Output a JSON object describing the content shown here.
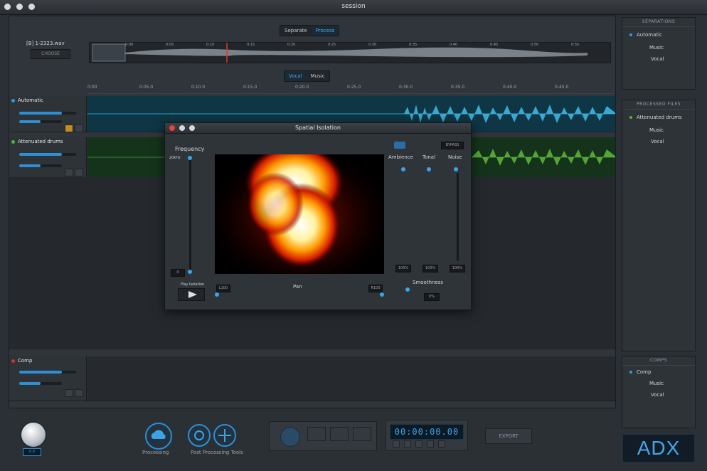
{
  "window": {
    "title": "session"
  },
  "mode_toggle": {
    "left": "Separate",
    "right": "Process"
  },
  "file": {
    "name": "[B] 1-2323.wav",
    "button": "CHOOSE"
  },
  "overview_ticks": [
    "0:00",
    "0:05",
    "0:10",
    "0:15",
    "0:20",
    "0:25",
    "0:30",
    "0:35",
    "0:40",
    "0:45",
    "0:50",
    "0:55"
  ],
  "view_toggle": {
    "left": "Vocal",
    "right": "Music"
  },
  "ruler_ticks": [
    "0:00",
    "0:05.0",
    "0:10.0",
    "0:15.0",
    "0:20.0",
    "0:25.0",
    "0:30.0",
    "0:35.0",
    "0:40.0",
    "0:45.0"
  ],
  "tracks": [
    {
      "name": "Automatic",
      "color": "#2b9de0"
    },
    {
      "name": "Attenuated drums",
      "color": "#58b33a"
    }
  ],
  "comp_track": {
    "name": "Comp",
    "color": "#d2332b"
  },
  "dialog": {
    "title": "Spatial Isolation",
    "frequency_label": "Frequency",
    "freq_top": "20kHz",
    "freq_bottom": "0",
    "play_label": "Play Isolation",
    "pan_label": "Pan",
    "pan_left": "L100",
    "pan_right": "R100",
    "bypass": "BYPASS",
    "ambience": "Ambience",
    "tonal": "Tonal",
    "noise": "Noise",
    "ambience_val": "100%",
    "tonal_val": "100%",
    "noise_val": "100%",
    "smoothness": "Smoothness",
    "smoothness_val": "0%"
  },
  "sidebar": {
    "separations": {
      "header": "SEPARATIONS",
      "items": [
        "Automatic",
        "Music",
        "Vocal"
      ]
    },
    "processed": {
      "header": "PROCESSED FILES",
      "items": [
        "Attenuated drums",
        "Music",
        "Vocal"
      ]
    },
    "comps": {
      "header": "COMPS",
      "items": [
        "Comp",
        "Music",
        "Vocal"
      ]
    }
  },
  "bottom": {
    "volume_label": "0.0",
    "processing_label": "Processing",
    "post_tools_label": "Post Processing Tools",
    "timecode": "00:00:00.00",
    "export_label": "EXPORT"
  },
  "logo": "ADX"
}
